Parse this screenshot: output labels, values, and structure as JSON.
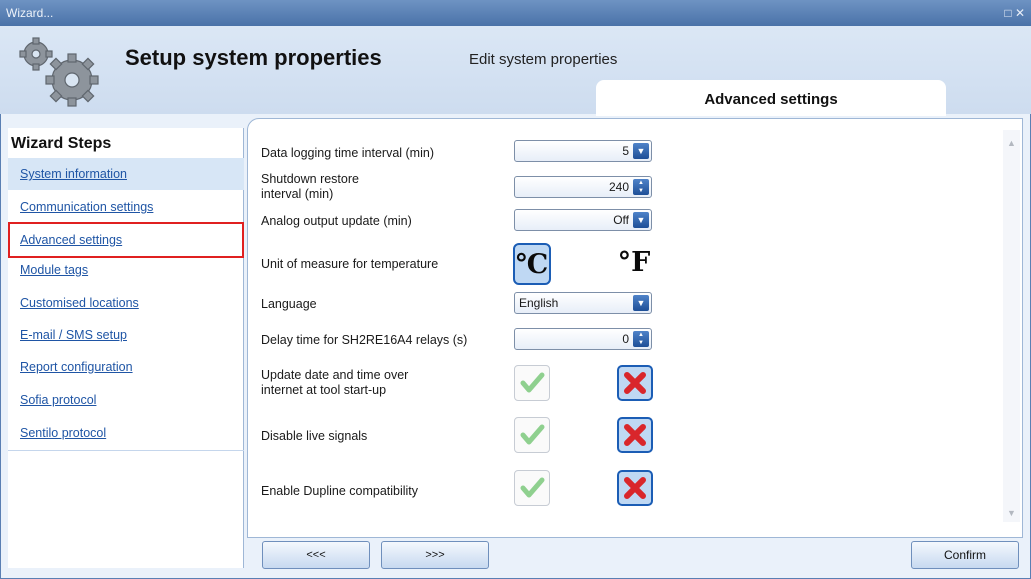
{
  "window": {
    "title": "Wizard...",
    "controls": "□ ✕"
  },
  "header": {
    "title": "Setup system properties",
    "subtitle": "Edit system properties",
    "active_tab": "Advanced settings"
  },
  "sidebar": {
    "heading": "Wizard Steps",
    "items": [
      {
        "label": "System information"
      },
      {
        "label": "Communication settings"
      },
      {
        "label": "Advanced settings"
      },
      {
        "label": "Module tags"
      },
      {
        "label": "Customised locations"
      },
      {
        "label": "E-mail / SMS setup"
      },
      {
        "label": "Report configuration"
      },
      {
        "label": "Sofia protocol"
      },
      {
        "label": "Sentilo protocol"
      }
    ]
  },
  "settings": {
    "data_logging": {
      "label": "Data logging time interval (min)",
      "value": "5"
    },
    "shutdown_restore": {
      "label_line1": "Shutdown restore",
      "label_line2": "interval (min)",
      "value": "240"
    },
    "analog_output": {
      "label": "Analog output update (min)",
      "value": "Off"
    },
    "temperature_unit": {
      "label": "Unit of measure for temperature",
      "celsius": "℃",
      "fahrenheit": "°F",
      "selected": "celsius"
    },
    "language": {
      "label": "Language",
      "value": "English"
    },
    "delay_time": {
      "label": "Delay time for SH2RE16A4 relays (s)",
      "value": "0"
    },
    "update_datetime": {
      "label_line1": "Update date and time over",
      "label_line2": "internet at tool start-up",
      "state": "disabled"
    },
    "disable_live": {
      "label": "Disable live signals",
      "state": "disabled"
    },
    "dupline": {
      "label": "Enable Dupline compatibility",
      "state": "disabled"
    }
  },
  "footer": {
    "prev_label": "<<<",
    "next_label": ">>>",
    "confirm_label": "Confirm"
  },
  "colors": {
    "link": "#1f55a5",
    "selection_border": "#1b5db5",
    "highlight_outline": "#e02020",
    "check_green": "#5cb85c",
    "x_red": "#d9262b"
  },
  "icons": {
    "logo": "gears-icon",
    "dropdown": "chevron-down-icon",
    "spinner": "spinner-arrows-icon",
    "enable": "checkmark-icon",
    "disable": "x-icon"
  }
}
